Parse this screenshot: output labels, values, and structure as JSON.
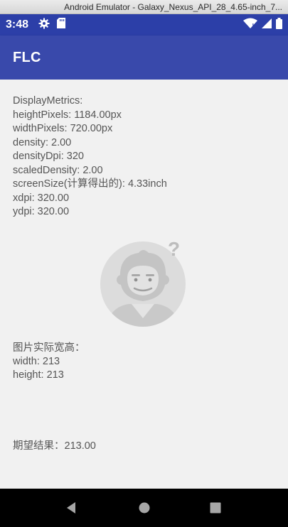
{
  "window": {
    "title": "Android Emulator - Galaxy_Nexus_API_28_4.65-inch_7..."
  },
  "status_bar": {
    "time": "3:48",
    "icons_left": [
      "gear-icon",
      "sd-card-icon"
    ],
    "icons_right": [
      "wifi-icon",
      "signal-icon",
      "battery-icon"
    ]
  },
  "app_bar": {
    "title": "FLC",
    "color": "#3949ab"
  },
  "display_metrics": {
    "header": "DisplayMetrics:",
    "height_pixels": "heightPixels: 1184.00px",
    "width_pixels": "widthPixels: 720.00px",
    "density": "density: 2.00",
    "density_dpi": "densityDpi: 320",
    "scaled_density": "scaledDensity: 2.00",
    "screen_size": "screenSize(计算得出的): 4.33inch",
    "xdpi": "xdpi: 320.00",
    "ydpi": "ydpi: 320.00"
  },
  "image_info": {
    "header": "图片实际宽高：",
    "width": "width: 213",
    "height": "height: 213"
  },
  "expected_result": "期望结果：213.00",
  "nav_bar": {
    "buttons": [
      "back-icon",
      "home-icon",
      "recents-icon"
    ]
  }
}
